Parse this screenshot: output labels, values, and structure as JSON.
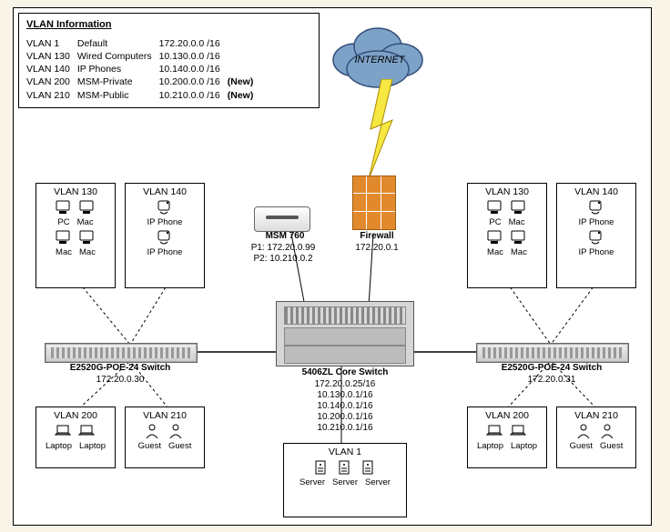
{
  "vlan_info": {
    "title": "VLAN Information",
    "rows": [
      {
        "id": "VLAN 1",
        "name": "Default",
        "subnet": "172.20.0.0 /16",
        "note": ""
      },
      {
        "id": "VLAN 130",
        "name": "Wired Computers",
        "subnet": "10.130.0.0 /16",
        "note": ""
      },
      {
        "id": "VLAN 140",
        "name": "IP Phones",
        "subnet": "10.140.0.0 /16",
        "note": ""
      },
      {
        "id": "VLAN 200",
        "name": "MSM-Private",
        "subnet": "10.200.0.0 /16",
        "note": "(New)"
      },
      {
        "id": "VLAN 210",
        "name": "MSM-Public",
        "subnet": "10.210.0.0 /16",
        "note": "(New)"
      }
    ]
  },
  "internet": {
    "label": "INTERNET"
  },
  "msm": {
    "name": "MSM 760",
    "p1": "P1: 172.20.0.99",
    "p2": "P2: 10.210.0.2"
  },
  "firewall": {
    "name": "Firewall",
    "ip": "172.20.0.1"
  },
  "core": {
    "name": "5406ZL Core Switch",
    "ips": [
      "172.20.0.25/16",
      "10.130.0.1/16",
      "10.140.0.1/16",
      "10.200.0.1/16",
      "10.210.0.1/16"
    ]
  },
  "left_switch": {
    "name": "E2520G-POE-24 Switch",
    "ip": "172.20.0.30"
  },
  "right_switch": {
    "name": "E2520G-POE-24 Switch",
    "ip": "172.20.0.31"
  },
  "left": {
    "box130": {
      "title": "VLAN 130",
      "t": [
        "PC",
        "Mac",
        "Mac",
        "Mac"
      ]
    },
    "box140": {
      "title": "VLAN 140",
      "t": [
        "IP Phone",
        "IP Phone"
      ]
    },
    "box200": {
      "title": "VLAN 200",
      "t": [
        "Laptop",
        "Laptop"
      ]
    },
    "box210": {
      "title": "VLAN 210",
      "t": [
        "Guest",
        "Guest"
      ]
    }
  },
  "right": {
    "box130": {
      "title": "VLAN 130",
      "t": [
        "PC",
        "Mac",
        "Mac",
        "Mac"
      ]
    },
    "box140": {
      "title": "VLAN 140",
      "t": [
        "IP Phone",
        "IP Phone"
      ]
    },
    "box200": {
      "title": "VLAN 200",
      "t": [
        "Laptop",
        "Laptop"
      ]
    },
    "box210": {
      "title": "VLAN 210",
      "t": [
        "Guest",
        "Guest"
      ]
    }
  },
  "vlan1": {
    "title": "VLAN 1",
    "t": [
      "Server",
      "Server",
      "Server"
    ]
  }
}
